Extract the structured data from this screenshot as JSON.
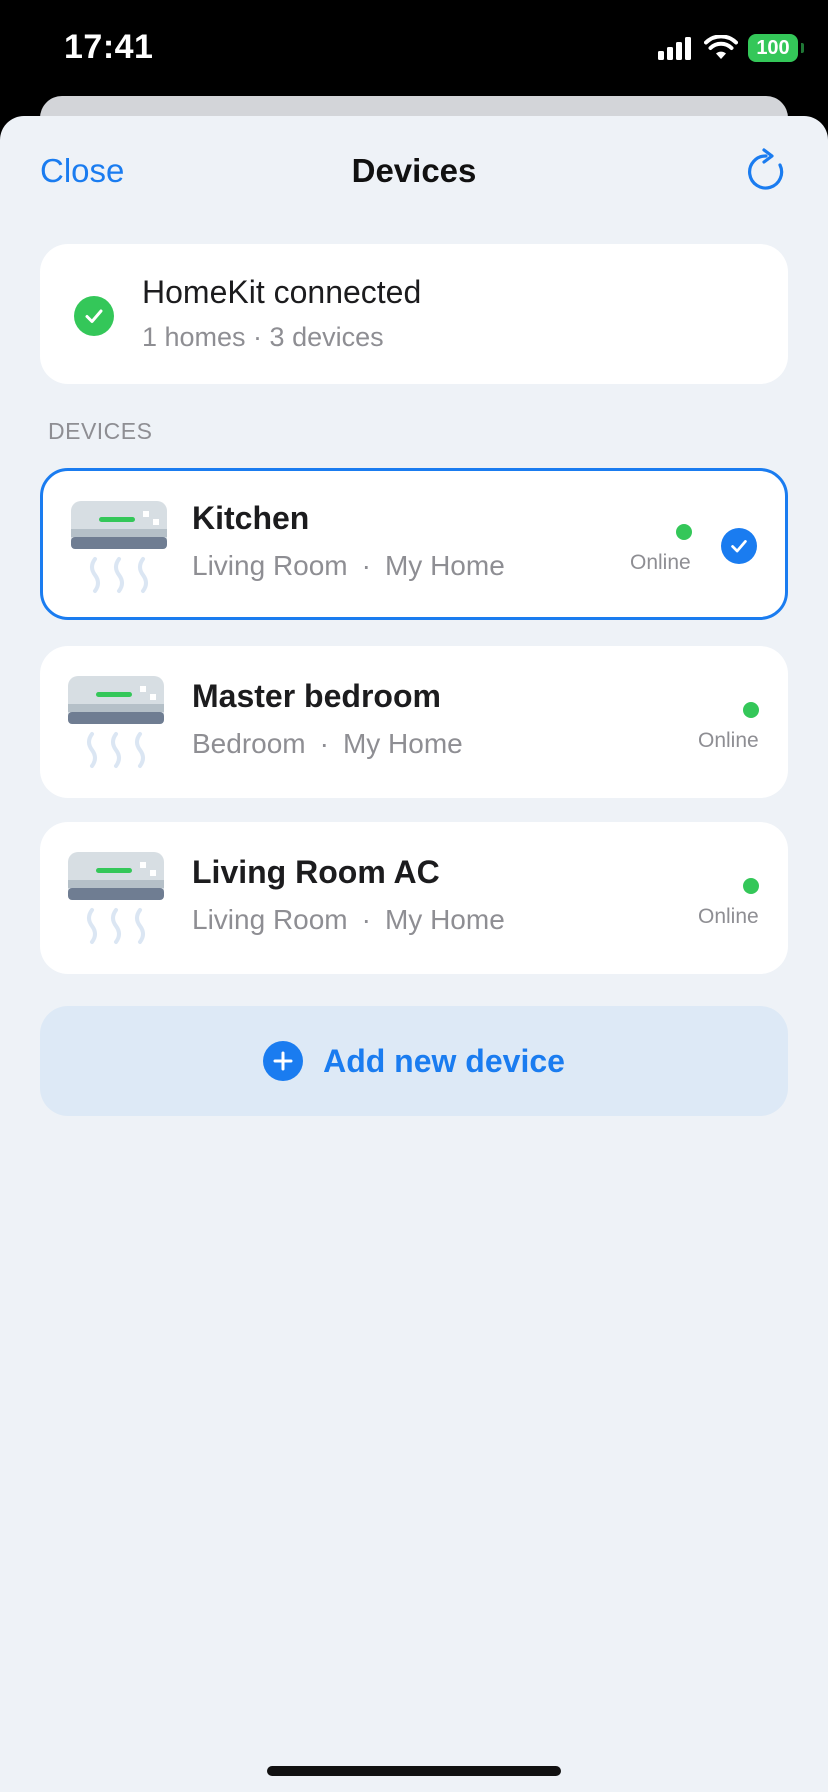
{
  "status_bar": {
    "time": "17:41",
    "battery": "100",
    "icons": [
      "signal-icon",
      "wifi-icon",
      "battery-icon"
    ]
  },
  "nav": {
    "close_label": "Close",
    "title": "Devices",
    "refresh_icon": "refresh-icon"
  },
  "homekit": {
    "title": "HomeKit connected",
    "subtitle": "1 homes · 3 devices",
    "status_icon": "check-circle-icon"
  },
  "section_header": "DEVICES",
  "devices": [
    {
      "name": "Kitchen",
      "room": "Living Room",
      "home": "My Home",
      "separator": "·",
      "status": "Online",
      "selected": true,
      "icon": "air-conditioner-icon"
    },
    {
      "name": "Master bedroom",
      "room": "Bedroom",
      "home": "My Home",
      "separator": "·",
      "status": "Online",
      "selected": false,
      "icon": "air-conditioner-icon"
    },
    {
      "name": "Living Room AC",
      "room": "Living Room",
      "home": "My Home",
      "separator": "·",
      "status": "Online",
      "selected": false,
      "icon": "air-conditioner-icon"
    }
  ],
  "add_button": {
    "label": "Add new device",
    "icon": "plus-circle-icon"
  },
  "colors": {
    "accent": "#1a7cf0",
    "online": "#34c759",
    "background": "#eef2f7",
    "card": "#ffffff",
    "secondary_text": "#8e8e93"
  }
}
